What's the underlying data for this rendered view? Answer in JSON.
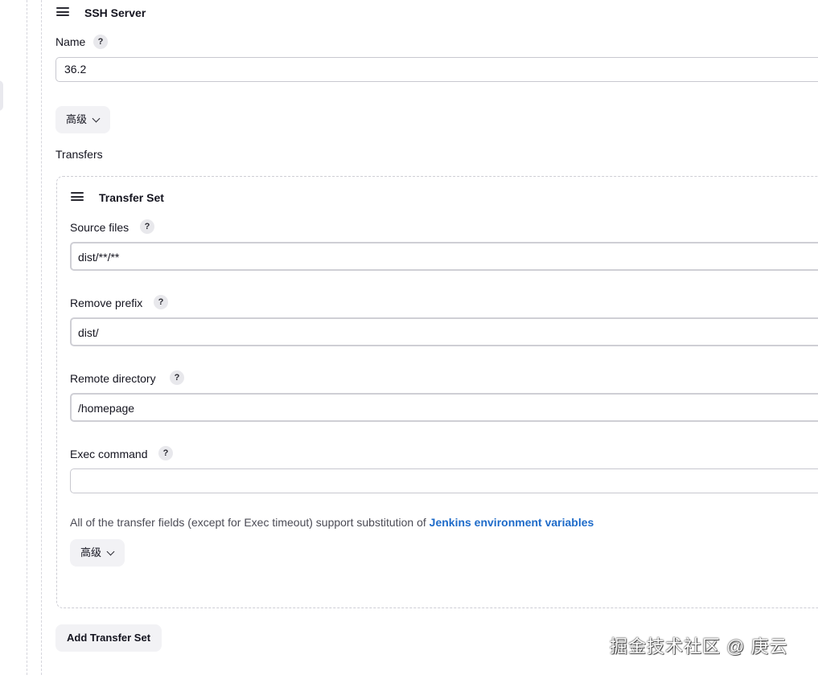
{
  "ssh_server": {
    "heading": "SSH Server",
    "name_label": "Name",
    "name_help": "?",
    "name_value": "36.2",
    "advanced_label": "高级"
  },
  "transfers": {
    "label": "Transfers",
    "transfer_set": {
      "heading": "Transfer Set",
      "source_files_label": "Source files",
      "source_files_value": "dist/**/**",
      "remove_prefix_label": "Remove prefix",
      "remove_prefix_value": "dist/",
      "remote_directory_label": "Remote directory",
      "remote_directory_value": "/homepage",
      "exec_command_label": "Exec command",
      "exec_command_value": "",
      "help": "?",
      "note_text": "All of the transfer fields (except for Exec timeout) support substitution of",
      "note_link": "Jenkins environment variables",
      "advanced_label": "高级"
    },
    "add_button": "Add Transfer Set"
  },
  "watermark": "掘金技术社区 @ 庚云",
  "colors": {
    "link": "#1e6bc9",
    "button_bg": "#f2f2f5",
    "border": "#c8c8cf"
  }
}
